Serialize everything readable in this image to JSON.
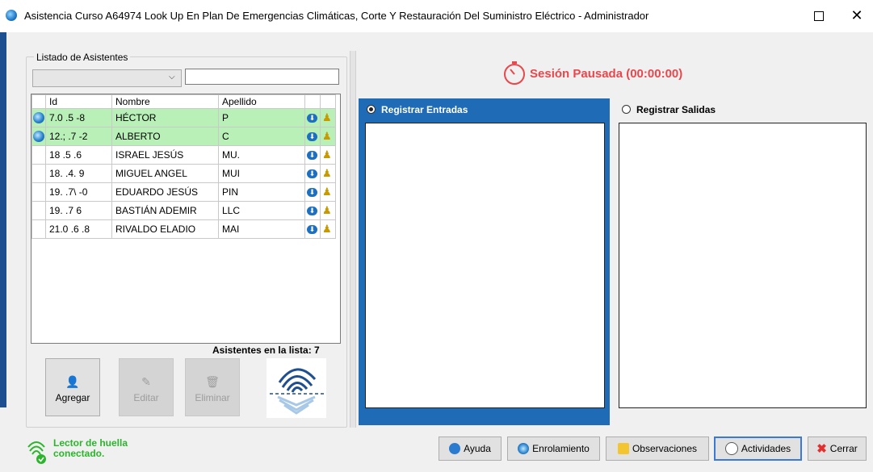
{
  "window": {
    "title": "Asistencia Curso A64974 Look Up En Plan De Emergencias Climáticas, Corte Y Restauración Del Suministro Eléctrico - Administrador",
    "maximize": "☐",
    "close": "✕"
  },
  "left": {
    "group_label": "Listado de Asistentes",
    "combo_value": "",
    "combo_arrow": "⌵",
    "search_value": "",
    "columns": [
      "Id",
      "Nombre",
      "Apellido"
    ],
    "rows": [
      {
        "id": "7.0   .5  -8",
        "nombre": "HÉCTOR",
        "apellido": "P",
        "highlight": true,
        "fingerprint": true
      },
      {
        "id": "12.;   .7  -2",
        "nombre": "ALBERTO",
        "apellido": "C",
        "highlight": true,
        "fingerprint": true
      },
      {
        "id": "18      .5  .6",
        "nombre": "ISRAEL JESÚS",
        "apellido": "MU.",
        "highlight": false,
        "fingerprint": false
      },
      {
        "id": "18.     .4.  9",
        "nombre": "MIGUEL ANGEL",
        "apellido": "MUI",
        "highlight": false,
        "fingerprint": false
      },
      {
        "id": "19.     .7\\  -0",
        "nombre": "EDUARDO JESÚS",
        "apellido": "PIN",
        "highlight": false,
        "fingerprint": false
      },
      {
        "id": "19.     .7    6",
        "nombre": "BASTIÁN ADEMIR",
        "apellido": "LLC",
        "highlight": false,
        "fingerprint": false
      },
      {
        "id": "21.0   .6   .8",
        "nombre": "RIVALDO ELADIO",
        "apellido": "MAI",
        "highlight": false,
        "fingerprint": false
      }
    ],
    "count_label": "Asistentes en la lista: 7",
    "buttons": {
      "add": "Agregar",
      "edit": "Editar",
      "delete": "Eliminar"
    }
  },
  "right": {
    "session_status": "Sesión Pausada (00:00:00)",
    "entries_label": "Registrar Entradas",
    "exits_label": "Registrar Salidas",
    "entries_selected": true
  },
  "footer": {
    "reader_status_line1": "Lector de huella",
    "reader_status_line2": "conectado.",
    "help": "Ayuda",
    "enrollment": "Enrolamiento",
    "observations": "Observaciones",
    "activities": "Actividades",
    "close": "Cerrar"
  },
  "colors": {
    "accent_blue": "#1f6bb5",
    "highlight_green": "#b8f0b8",
    "session_red": "#e8474c",
    "reader_green": "#2bb52b"
  }
}
